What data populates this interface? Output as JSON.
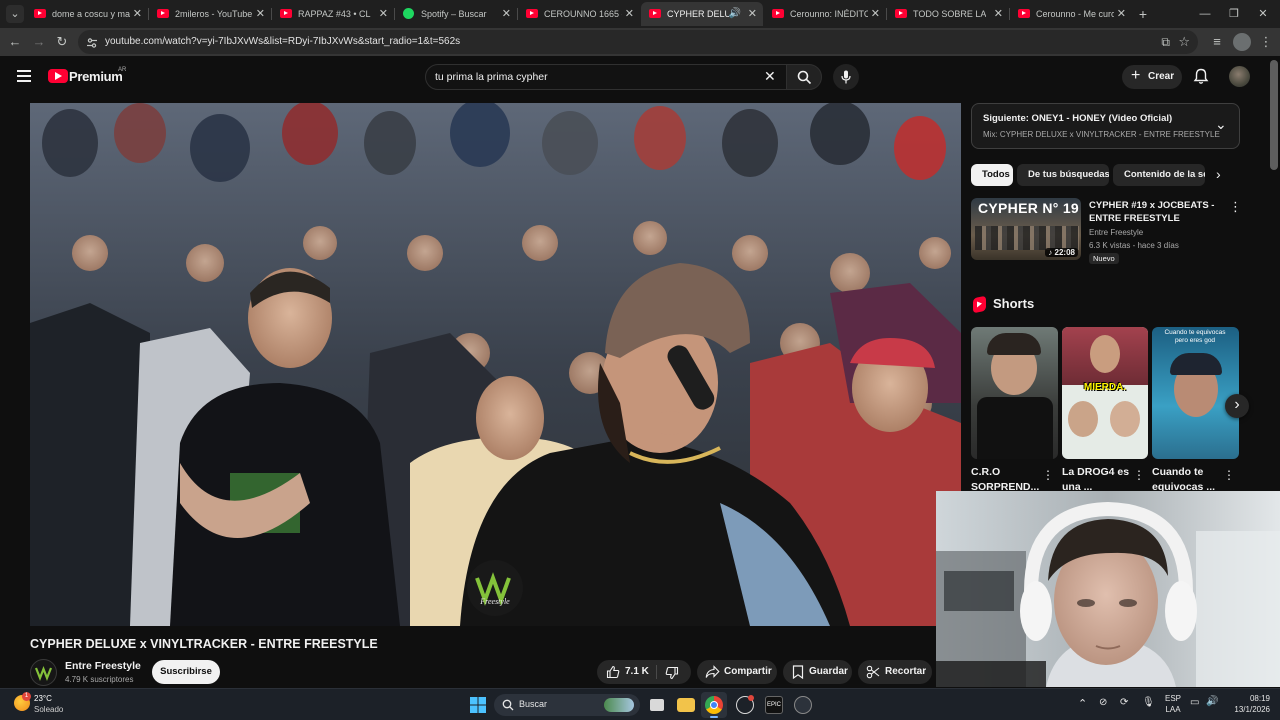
{
  "browser": {
    "tabs": [
      {
        "title": "dome a coscu y maz",
        "favicon": "youtube-icon",
        "active": false
      },
      {
        "title": "2mileros - YouTube",
        "favicon": "youtube-icon",
        "active": false
      },
      {
        "title": "RAPPAZ #43 • CL",
        "favicon": "youtube-icon",
        "active": false
      },
      {
        "title": "Spotify – Buscar",
        "favicon": "spotify-icon",
        "active": false
      },
      {
        "title": "CEROUNNO 1665 - Y",
        "favicon": "youtube-icon",
        "active": false
      },
      {
        "title": "CYPHER DELUXE",
        "favicon": "youtube-icon",
        "active": true
      },
      {
        "title": "Cerounno: INÉDITO (",
        "favicon": "youtube-icon",
        "active": false
      },
      {
        "title": "TODO SOBRE LA",
        "favicon": "youtube-icon",
        "active": false
      },
      {
        "title": "Cerounno - Me curo",
        "favicon": "youtube-icon",
        "active": false
      }
    ],
    "url": "youtube.com/watch?v=yi-7IbJXvWs&list=RDyi-7IbJXvWs&start_radio=1&t=562s"
  },
  "header": {
    "logo_text": "Premium",
    "logo_region": "AR",
    "search_value": "tu prima la prima cypher",
    "create_label": "Crear"
  },
  "video": {
    "title": "CYPHER DELUXE x VINYLTRACKER - ENTRE FREESTYLE",
    "watermark": "Freestyle"
  },
  "channel": {
    "name": "Entre Freestyle",
    "subscribers": "4.79 K suscriptores",
    "subscribe_label": "Suscribirse"
  },
  "actions": {
    "likes": "7.1 K",
    "share": "Compartir",
    "save": "Guardar",
    "clip": "Recortar"
  },
  "sidebar": {
    "up_next_title": "Siguiente: ONEY1 - HONEY (Video Oficial)",
    "up_next_mix": "Mix: CYPHER DELUXE x VINYLTRACKER - ENTRE FREESTYLE",
    "chips": [
      "Todos",
      "De tus búsquedas",
      "Contenido de la ser"
    ],
    "recommended": {
      "thumb_text": "CYPHER N° 19",
      "title": "CYPHER #19 x JOCBEATS - ENTRE FREESTYLE",
      "channel": "Entre Freestyle",
      "meta": "6.3 K vistas - hace 3 días",
      "badge": "Nuevo",
      "duration": "22:08"
    },
    "shorts_label": "Shorts",
    "shorts": [
      {
        "title": "C.R.O SORPREND...",
        "overlay": ""
      },
      {
        "title": "La DROG4 es una ...",
        "overlay": "MIERDA."
      },
      {
        "title": "Cuando te equivocas ...",
        "overlay": "Cuando te equivocas pero eres god"
      }
    ]
  },
  "taskbar": {
    "weather_temp": "23°C",
    "weather_desc": "Soleado",
    "weather_badge": "1",
    "search_placeholder": "Buscar",
    "lang": "ESP",
    "lang2": "LAA",
    "time": "08:19",
    "date": "13/1/2026"
  }
}
